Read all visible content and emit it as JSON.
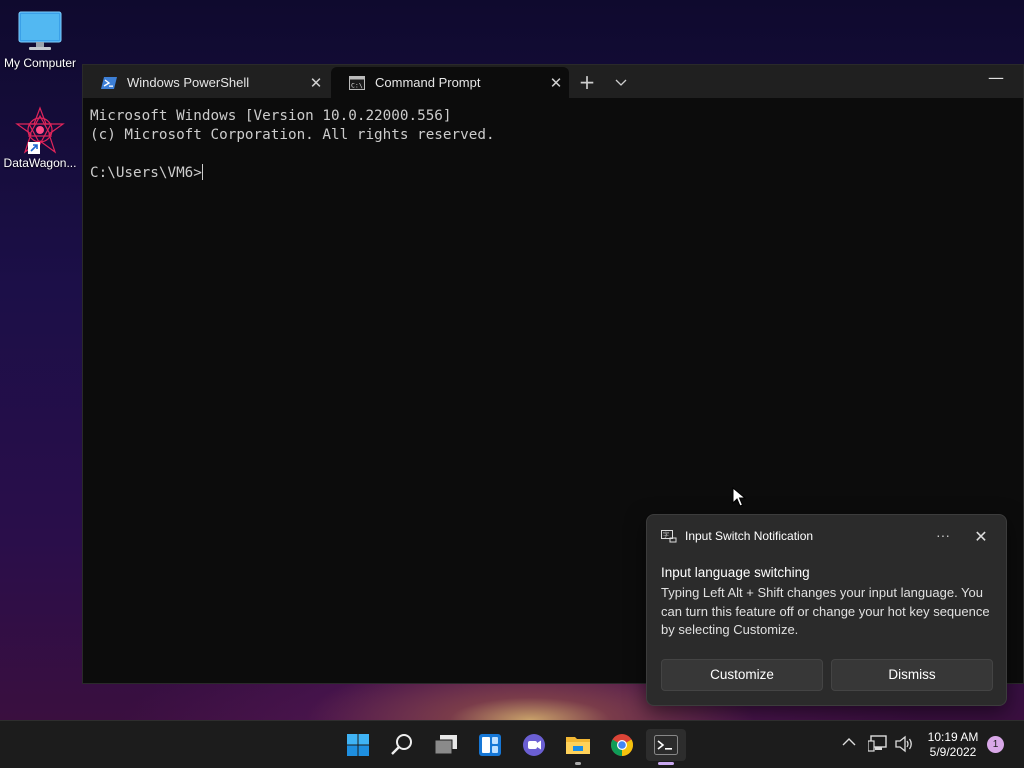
{
  "desktop": {
    "icons": [
      {
        "label": "My Computer",
        "icon": "monitor-icon"
      },
      {
        "label": "DataWagon...",
        "icon": "datawagon-shortcut-icon"
      }
    ]
  },
  "terminal": {
    "tabs": [
      {
        "label": "Windows PowerShell",
        "icon": "powershell-icon",
        "active": false
      },
      {
        "label": "Command Prompt",
        "icon": "cmd-icon",
        "active": true
      }
    ],
    "new_tab": "+",
    "dropdown": "⌄",
    "minimize": "—",
    "console_lines": [
      "Microsoft Windows [Version 10.0.22000.556]",
      "(c) Microsoft Corporation. All rights reserved.",
      "",
      "C:\\Users\\VM6>"
    ]
  },
  "notification": {
    "app_name": "Input Switch Notification",
    "more": "···",
    "close": "✕",
    "title": "Input language switching",
    "body": "Typing Left Alt + Shift changes your input language. You can turn this feature off or change your hot key sequence by selecting Customize.",
    "buttons": {
      "customize": "Customize",
      "dismiss": "Dismiss"
    }
  },
  "taskbar": {
    "items": [
      "start-icon",
      "search-icon",
      "task-view-icon",
      "widgets-icon",
      "chat-icon",
      "file-explorer-icon",
      "chrome-icon",
      "terminal-icon"
    ],
    "clock": {
      "time": "10:19 AM",
      "date": "5/9/2022"
    },
    "notification_count": "1"
  },
  "colors": {
    "accent": "#0078d4",
    "toast_bg": "#2b2b2b",
    "terminal_bg": "#0c0c0c"
  }
}
